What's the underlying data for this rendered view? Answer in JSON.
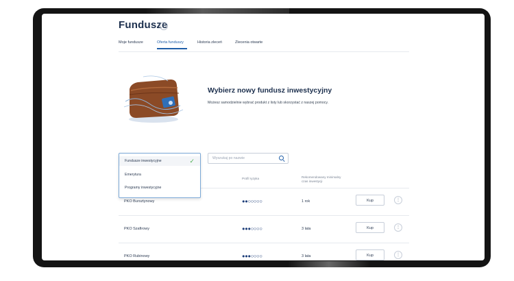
{
  "page": {
    "title": "Fundusze",
    "info_icon": "info-icon"
  },
  "tabs": [
    {
      "label": "Moje fundusze",
      "active": false
    },
    {
      "label": "Oferta funduszy",
      "active": true
    },
    {
      "label": "Historia zleceń",
      "active": false
    },
    {
      "label": "Zlecenia otwarte",
      "active": false
    }
  ],
  "hero": {
    "title": "Wybierz nowy fundusz inwestycyjny",
    "subtitle": "Możesz samodzielnie wybrać produkt z listy lub skorzystać z naszej pomocy."
  },
  "filter_dropdown": {
    "options": [
      {
        "label": "Fundusze inwestycyjne",
        "selected": true
      },
      {
        "label": "Emerytura",
        "selected": false
      },
      {
        "label": "Programy inwestycyjne",
        "selected": false
      }
    ]
  },
  "search": {
    "placeholder": "Wyszukaj po nazwie"
  },
  "table": {
    "columns": {
      "risk": "Profil ryzyka",
      "period": "Rekomendowany minimalny czas inwestycji"
    },
    "rows": [
      {
        "name": "PKO Bursztynowy",
        "risk_level": 2,
        "risk_max": 7,
        "period": "1 rok",
        "buy_label": "Kup"
      },
      {
        "name": "PKO Szafirowy",
        "risk_level": 3,
        "risk_max": 7,
        "period": "3 lata",
        "buy_label": "Kup"
      },
      {
        "name": "PKO Rubinowy",
        "risk_level": 3,
        "risk_max": 7,
        "period": "3 lata",
        "buy_label": "Kup"
      }
    ]
  },
  "colors": {
    "accent": "#1f5ea8",
    "title": "#1c2f4d",
    "check": "#4caf50",
    "wallet": "#8b4a26"
  }
}
